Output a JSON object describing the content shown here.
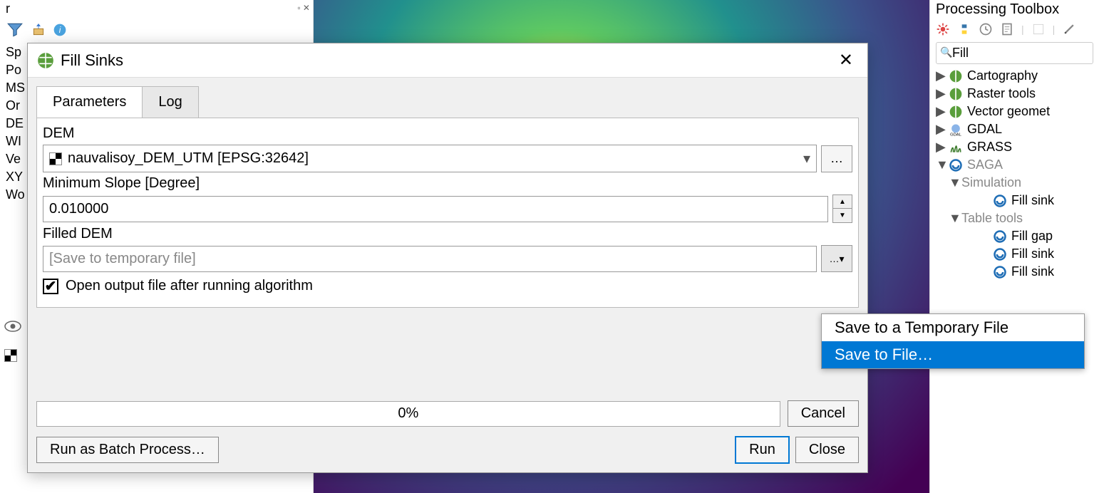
{
  "layers_panel": {
    "title_fragment": "r",
    "items": [
      "Sp",
      "Po",
      "MS",
      "Or",
      "DE",
      "WI",
      "Ve",
      "XY",
      "Wo"
    ]
  },
  "toolbox": {
    "title": "Processing Toolbox",
    "search_value": "Fill",
    "tree": {
      "cartography": "Cartography",
      "raster_tools": "Raster tools",
      "vector_geometry": "Vector geomet",
      "gdal": "GDAL",
      "grass": "GRASS",
      "saga": "SAGA",
      "simulation": "Simulation",
      "fill_sinks_sim": "Fill sink",
      "table_tools": "Table tools",
      "fill_gaps": "Fill gap",
      "fill_sinks_a": "Fill sink",
      "fill_sinks_b": "Fill sink"
    }
  },
  "dialog": {
    "title": "Fill Sinks",
    "tabs": {
      "parameters": "Parameters",
      "log": "Log"
    },
    "dem_label": "DEM",
    "dem_value": "nauvalisoy_DEM_UTM [EPSG:32642]",
    "min_slope_label": "Minimum Slope [Degree]",
    "min_slope_value": "0.010000",
    "filled_dem_label": "Filled DEM",
    "filled_dem_placeholder": "[Save to temporary file]",
    "open_output_label": "Open output file after running algorithm",
    "progress_text": "0%",
    "cancel": "Cancel",
    "batch": "Run as Batch Process…",
    "run": "Run",
    "close": "Close"
  },
  "save_menu": {
    "temp": "Save to a Temporary File",
    "file": "Save to File…"
  },
  "icons": {
    "browse": "…",
    "drop_tri": "▾",
    "up": "▲",
    "down": "▼",
    "check": "✔",
    "close_x": "✕",
    "expand_right": "▶",
    "expand_down": "▼",
    "dock_small": "▫ ✕"
  }
}
